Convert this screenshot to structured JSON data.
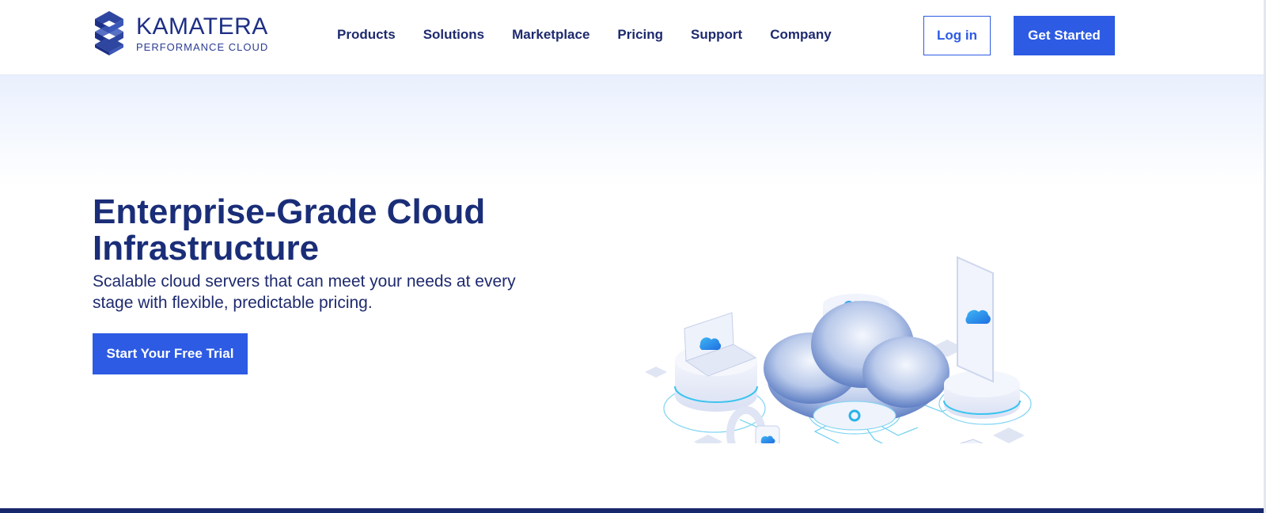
{
  "brand": {
    "name": "KAMATERA",
    "tagline": "PERFORMANCE CLOUD"
  },
  "nav": {
    "items": [
      {
        "label": "Products"
      },
      {
        "label": "Solutions"
      },
      {
        "label": "Marketplace"
      },
      {
        "label": "Pricing"
      },
      {
        "label": "Support"
      },
      {
        "label": "Company"
      }
    ]
  },
  "header": {
    "login_label": "Log in",
    "get_started_label": "Get Started"
  },
  "hero": {
    "title": "Enterprise-Grade Cloud Infrastructure",
    "subtitle": "Scalable cloud servers that can meet your needs at every stage with flexible, predictable pricing.",
    "cta_label": "Start Your Free Trial"
  },
  "colors": {
    "accent": "#2d5be3",
    "brand_navy": "#1a2d78",
    "footer_band": "#17276b"
  }
}
